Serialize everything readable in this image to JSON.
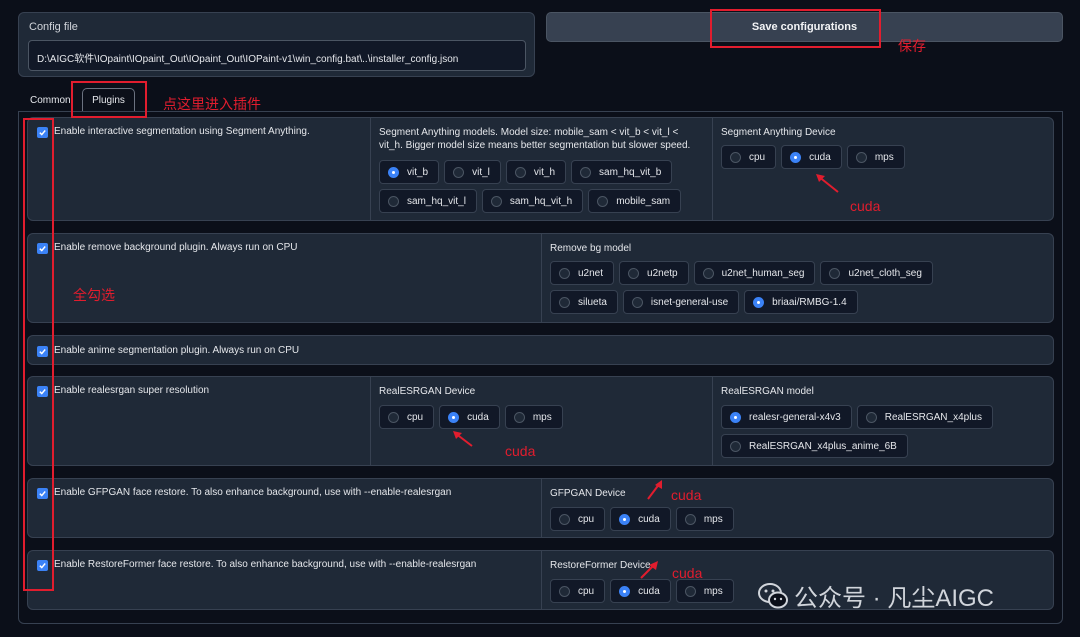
{
  "config": {
    "label": "Config file",
    "path": "D:\\AIGC软件\\IOpaint\\IOpaint_Out\\IOpaint_Out\\IOPaint-v1\\win_config.bat\\..\\installer_config.json"
  },
  "save_label": "Save configurations",
  "tabs": {
    "common": "Common",
    "plugins": "Plugins"
  },
  "plugins": {
    "sam": {
      "enable": "Enable interactive segmentation using Segment Anything.",
      "models_label": "Segment Anything models. Model size: mobile_sam < vit_b < vit_l < vit_h. Bigger model size means better segmentation but slower speed.",
      "models": [
        "vit_b",
        "vit_l",
        "vit_h",
        "sam_hq_vit_b",
        "sam_hq_vit_l",
        "sam_hq_vit_h",
        "mobile_sam"
      ],
      "models_selected": "vit_b",
      "device_label": "Segment Anything Device",
      "devices": [
        "cpu",
        "cuda",
        "mps"
      ],
      "device_selected": "cuda"
    },
    "rembg": {
      "enable": "Enable remove background plugin. Always run on CPU",
      "model_label": "Remove bg model",
      "models": [
        "u2net",
        "u2netp",
        "u2net_human_seg",
        "u2net_cloth_seg",
        "silueta",
        "isnet-general-use",
        "briaai/RMBG-1.4"
      ],
      "model_selected": "briaai/RMBG-1.4"
    },
    "anime": {
      "enable": "Enable anime segmentation plugin. Always run on CPU"
    },
    "realesrgan": {
      "enable": "Enable realesrgan super resolution",
      "device_label": "RealESRGAN Device",
      "devices": [
        "cpu",
        "cuda",
        "mps"
      ],
      "device_selected": "cuda",
      "model_label": "RealESRGAN model",
      "models": [
        "realesr-general-x4v3",
        "RealESRGAN_x4plus",
        "RealESRGAN_x4plus_anime_6B"
      ],
      "model_selected": "realesr-general-x4v3"
    },
    "gfpgan": {
      "enable": "Enable GFPGAN face restore. To also enhance background, use with --enable-realesrgan",
      "device_label": "GFPGAN Device",
      "devices": [
        "cpu",
        "cuda",
        "mps"
      ],
      "device_selected": "cuda"
    },
    "restoreformer": {
      "enable": "Enable RestoreFormer face restore. To also enhance background, use with --enable-realesrgan",
      "device_label": "RestoreFormer Device",
      "devices": [
        "cpu",
        "cuda",
        "mps"
      ],
      "device_selected": "cuda"
    }
  },
  "annotations": {
    "save": "保存",
    "plugins_hint": "点这里进入插件",
    "select_all": "全勾选",
    "cuda1": "cuda",
    "cuda2": "cuda",
    "cuda3": "cuda",
    "cuda4": "cuda"
  },
  "watermark": "公众号 · 凡尘AIGC",
  "colors": {
    "accent": "#3b82f6",
    "annotation": "#e11d2e",
    "background": "#0b0f19",
    "card": "#1f2937"
  }
}
